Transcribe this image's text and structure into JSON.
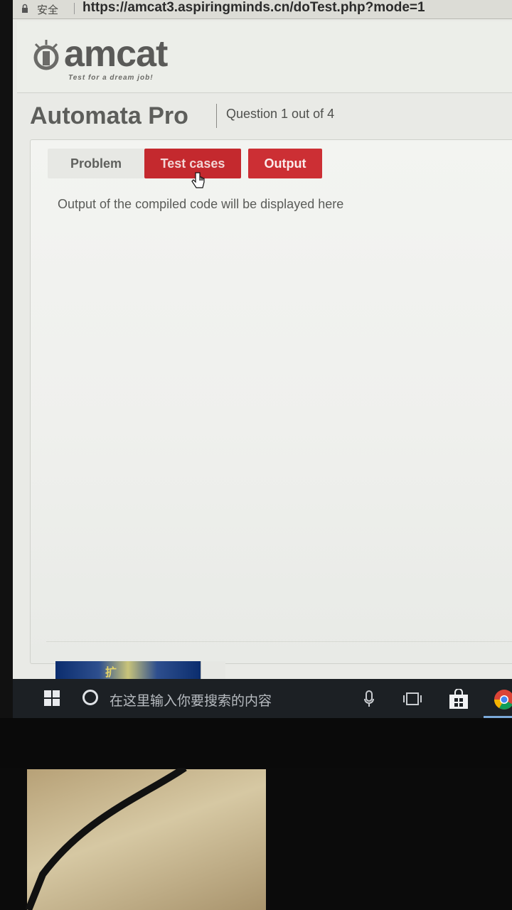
{
  "browser": {
    "secure_label": "安全",
    "url": "https://amcat3.aspiringminds.cn/doTest.php?mode=1"
  },
  "header": {
    "logo_text": "amcat",
    "tagline": "Test for a dream job!"
  },
  "title_row": {
    "app_title": "Automata Pro",
    "question_progress": "Question 1 out of 4"
  },
  "tabs": [
    {
      "label": "Problem",
      "active": false
    },
    {
      "label": "Test cases",
      "active": true
    },
    {
      "label": "Output",
      "active": false
    }
  ],
  "output_panel": {
    "message": "Output of the compiled code will be displayed here"
  },
  "thumbnail": {
    "text": "扩"
  },
  "taskbar": {
    "search_placeholder": "在这里输入你要搜索的内容",
    "icons": [
      "windows-start-icon",
      "cortana-icon",
      "microphone-icon",
      "task-view-icon",
      "store-icon",
      "chrome-icon"
    ]
  },
  "colors": {
    "tab_red": "#c4292e",
    "taskbar_bg": "#1c2024",
    "panel_bg": "#f3f4f1"
  }
}
